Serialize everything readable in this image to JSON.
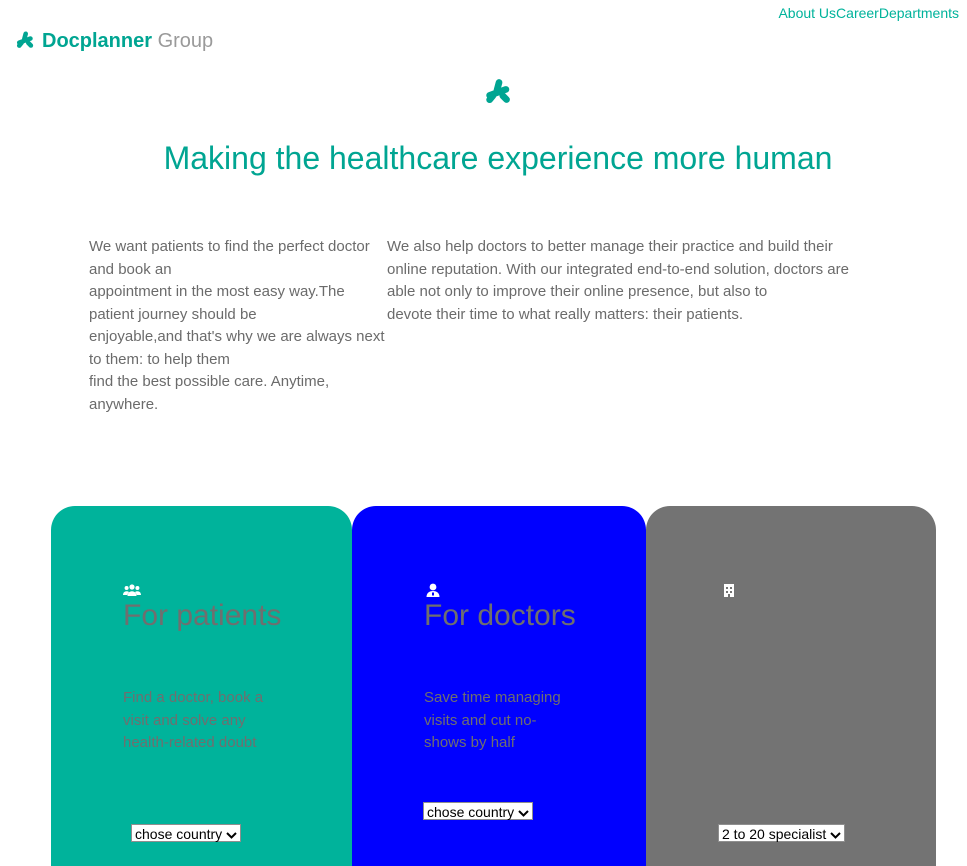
{
  "nav": {
    "about": "About Us",
    "career": "Career",
    "departments": "Departments"
  },
  "logo": {
    "brand": "Docplanner",
    "group": "Group",
    "icon": "docplanner-mark-icon"
  },
  "hero": {
    "icon": "docplanner-mark-icon",
    "headline": "Making the healthcare experience more human"
  },
  "intro": {
    "left": "We want patients to find the perfect doctor and book an\nappointment in the most easy way.The patient journey should be\nenjoyable,and that's why we are always next to them: to help them\nfind the best possible care. Anytime, anywhere.",
    "right": "We also help doctors to better manage their practice and build their online reputation. With our integrated end-to-end solution, doctors are able not only to improve their online presence, but also to\ndevote their time to what really matters: their patients."
  },
  "cards": [
    {
      "icon": "users-icon",
      "title": "For patients",
      "text": "Find a doctor, book a visit and solve any health-related doubt",
      "select": "chose country",
      "background": "#00b39b"
    },
    {
      "icon": "doctor-icon",
      "title": "For doctors",
      "text": "Save time managing visits and cut no-shows by half",
      "select": "chose country",
      "background": "#0000ff"
    },
    {
      "icon": "hospital-icon",
      "title": "",
      "text": "",
      "select": "2 to 20 specialist",
      "background": "#737373"
    }
  ],
  "colors": {
    "accent": "#00a592",
    "nav_link": "#00b39b",
    "body_text": "#6b6b6b",
    "card_text": "#6f6f6f"
  }
}
